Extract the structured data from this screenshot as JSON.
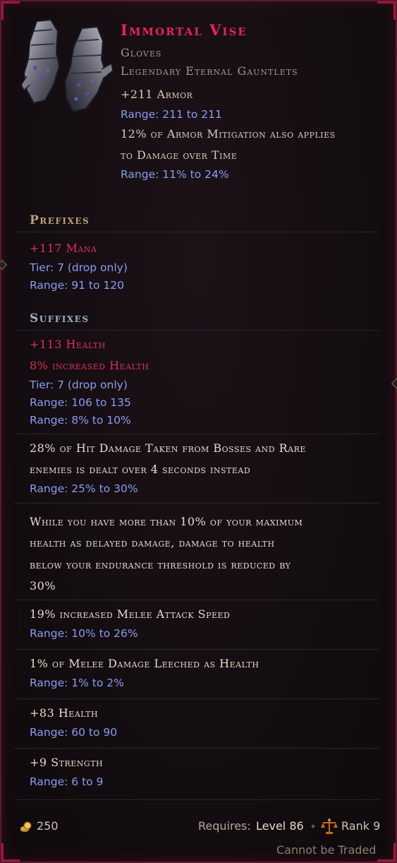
{
  "item": {
    "name": "Immortal Vise",
    "subtype": "Gloves",
    "rarity_base": "Legendary Eternal Gauntlets"
  },
  "implicits": [
    {
      "text": "+211 Armor",
      "range": "Range: 211 to 211"
    },
    {
      "text_line1": "12% of Armor Mitigation also applies",
      "text_line2": "to Damage over Time",
      "range": "Range: 11% to 24%"
    }
  ],
  "prefixes": {
    "header": "Prefixes",
    "affix": {
      "text": "+117 Mana",
      "tier": "Tier: 7 (drop only)",
      "range": "Range: 91 to 120"
    }
  },
  "suffixes": {
    "header": "Suffixes",
    "affix": {
      "line1": "+113 Health",
      "line2": "8% increased Health",
      "tier": "Tier: 7 (drop only)",
      "range1": "Range: 106 to 135",
      "range2": "Range: 8% to 10%"
    }
  },
  "legendary_mods": [
    {
      "line1": "28% of Hit Damage Taken from Bosses and Rare",
      "line2": "enemies is dealt over 4 seconds instead",
      "range": "Range: 25% to 30%"
    },
    {
      "line1": "While you have more than 10% of your maximum",
      "line2": "health as delayed damage, damage to health",
      "line3": "below your endurance threshold is reduced by",
      "line4": "30%"
    },
    {
      "line1": "19% increased Melee Attack Speed",
      "range": "Range: 10% to 26%"
    },
    {
      "line1": "1% of Melee Damage Leeched as Health",
      "range": "Range: 1% to 2%"
    },
    {
      "line1": "+83 Health",
      "range": "Range: 60 to 90"
    },
    {
      "line1": "+9 Strength",
      "range": "Range: 6 to 9"
    }
  ],
  "footer": {
    "gold": "250",
    "requires_label": "Requires:",
    "requires_level": "Level 86",
    "rank": "Rank 9",
    "trade_status": "Cannot be Traded"
  },
  "colors": {
    "title": "#e8245a",
    "affix_red": "#e0305a",
    "range_blue": "#8c9cf0",
    "text_beige": "#d8ccb8",
    "frame": "#5a1a2c"
  },
  "icons": [
    "gauntlets-item-icon",
    "gold-coin-icon",
    "scales-rank-icon"
  ]
}
